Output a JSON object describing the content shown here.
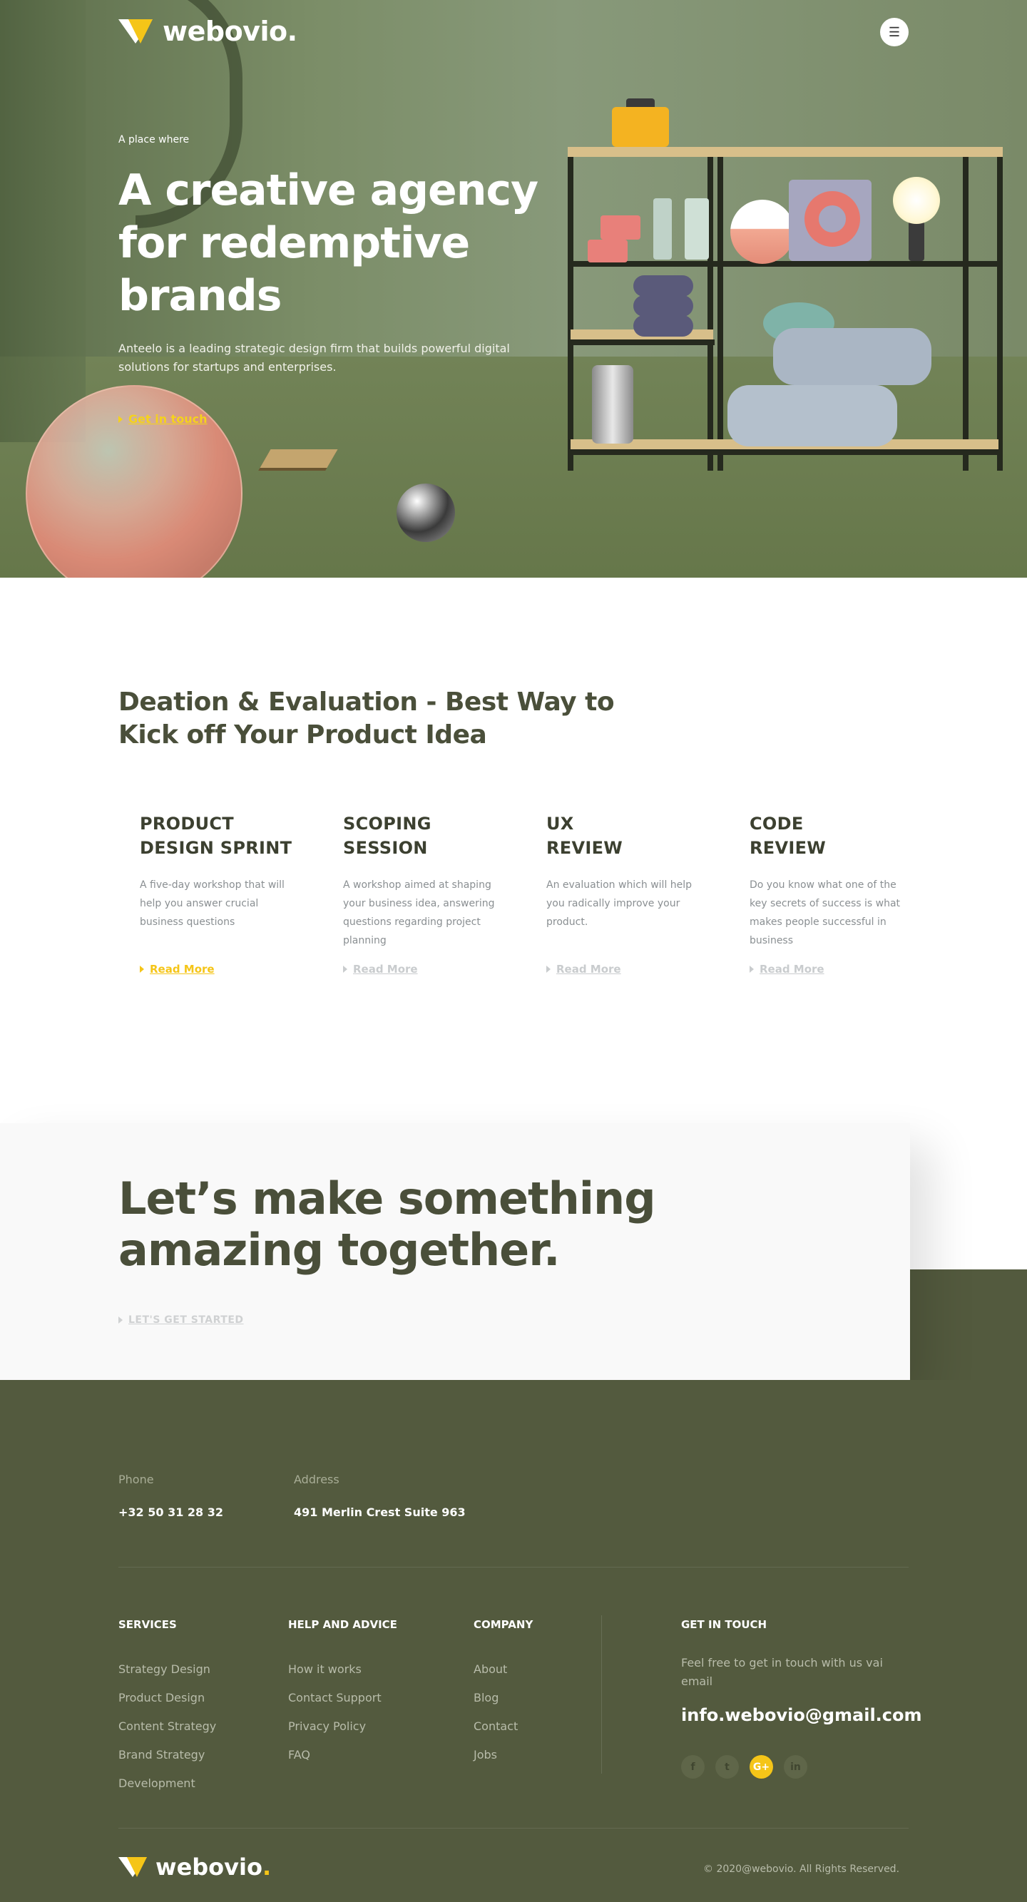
{
  "brand": {
    "name": "webovio.",
    "footer_name": "webovio",
    "footer_dot": "."
  },
  "nav": {
    "menu_icon": "hamburger-icon"
  },
  "hero": {
    "kicker": "A place where",
    "title": "A creative agency for redemptive brands",
    "description": "Anteelo is a leading strategic design firm that builds powerful digital solutions for startups and enterprises.",
    "cta": "Get in touch"
  },
  "services": {
    "title": "Deation & Evaluation - Best Way to Kick off Your Product Idea",
    "cards": [
      {
        "title_line1": "PRODUCT",
        "title_line2": "DESIGN SPRINT",
        "description": "A five-day workshop that will help you answer crucial business questions",
        "link": "Read More"
      },
      {
        "title_line1": "SCOPING",
        "title_line2": "SESSION",
        "description": "A workshop aimed at shaping your business idea, answering questions regarding project planning",
        "link": "Read More"
      },
      {
        "title_line1": "UX",
        "title_line2": "REVIEW",
        "description": "An evaluation which will help you radically improve your product.",
        "link": "Read More"
      },
      {
        "title_line1": "CODE",
        "title_line2": "REVIEW",
        "description": "Do you know what one of the key secrets of success is what makes people successful in business",
        "link": "Read More"
      }
    ]
  },
  "cta": {
    "title": "Let’s make something amazing together.",
    "link": "LET'S GET STARTED"
  },
  "footer": {
    "phone_label": "Phone",
    "phone_value": "+32 50 31 28 32",
    "address_label": "Address",
    "address_value": "491 Merlin Crest Suite 963",
    "columns": [
      {
        "title": "SERVICES",
        "items": [
          "Strategy Design",
          "Product Design",
          "Content Strategy",
          "Brand Strategy",
          "Development"
        ]
      },
      {
        "title": "HELP AND ADVICE",
        "items": [
          "How it works",
          "Contact Support",
          "Privacy Policy",
          "FAQ"
        ]
      },
      {
        "title": "COMPANY",
        "items": [
          "About",
          "Blog",
          "Contact",
          "Jobs"
        ]
      }
    ],
    "get_in_touch": {
      "title": "GET IN TOUCH",
      "description": "Feel free to get in touch with us vai email",
      "email": "info.webovio@gmail.com"
    },
    "socials": [
      {
        "icon": "facebook-icon",
        "glyph": "f"
      },
      {
        "icon": "twitter-icon",
        "glyph": "t"
      },
      {
        "icon": "google-plus-icon",
        "glyph": "G+"
      },
      {
        "icon": "linkedin-icon",
        "glyph": "in"
      }
    ],
    "copyright": "© 2020@webovio. All Rights Reserved."
  },
  "colors": {
    "accent": "#f5c518",
    "olive_dark": "#535a3e",
    "heading": "#4a4f3a"
  }
}
